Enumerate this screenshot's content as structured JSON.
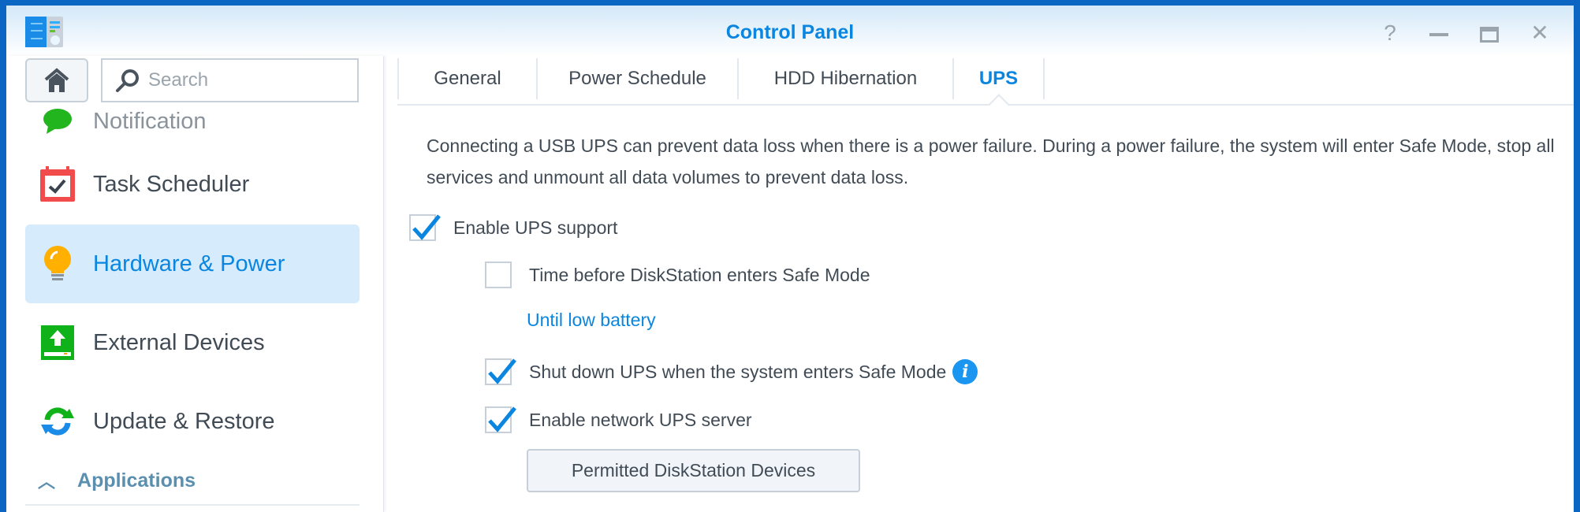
{
  "window": {
    "title": "Control Panel",
    "controls": [
      "help",
      "minimize",
      "maximize",
      "close"
    ]
  },
  "sidebar": {
    "search_placeholder": "Search",
    "items": [
      {
        "label": "Notification",
        "icon": "chat-bubble-icon"
      },
      {
        "label": "Task Scheduler",
        "icon": "calendar-check-icon"
      },
      {
        "label": "Hardware & Power",
        "icon": "lightbulb-icon",
        "active": true
      },
      {
        "label": "External Devices",
        "icon": "upload-drive-icon"
      },
      {
        "label": "Update & Restore",
        "icon": "refresh-icon"
      }
    ],
    "section": "Applications"
  },
  "tabs": [
    {
      "label": "General"
    },
    {
      "label": "Power Schedule"
    },
    {
      "label": "HDD Hibernation"
    },
    {
      "label": "UPS",
      "active": true
    }
  ],
  "ups": {
    "description": "Connecting a USB UPS can prevent data loss when there is a power failure. During a power failure, the system will enter Safe Mode, stop all services and unmount all data volumes to prevent data loss.",
    "enable_ups": {
      "label": "Enable UPS support",
      "checked": true
    },
    "time_before": {
      "label": "Time before DiskStation enters Safe Mode",
      "checked": false
    },
    "time_value": "Until low battery",
    "shutdown_ups": {
      "label": "Shut down UPS when the system enters Safe Mode",
      "checked": true
    },
    "network_server": {
      "label": "Enable network UPS server",
      "checked": true
    },
    "permitted_button": "Permitted DiskStation Devices"
  },
  "colors": {
    "accent": "#0a86e0",
    "active_bg": "#d6ebfb",
    "frame": "#0a66c2"
  }
}
